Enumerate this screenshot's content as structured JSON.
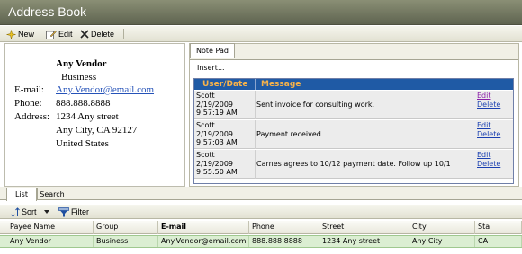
{
  "window": {
    "title": "Address Book"
  },
  "toolbar": {
    "new_label": "New",
    "edit_label": "Edit",
    "delete_label": "Delete"
  },
  "vendor": {
    "name": "Any Vendor",
    "type": "Business",
    "email_label": "E-mail:",
    "email": "Any.Vendor@email.com",
    "phone_label": "Phone:",
    "phone": "888.888.8888",
    "address_label": "Address:",
    "address_line1": "1234 Any street",
    "address_line2": "Any City, CA 92127",
    "address_line3": "United States"
  },
  "notepad": {
    "tab_label": "Note Pad",
    "insert_label": "Insert...",
    "col_user_date": "User/Date",
    "col_message": "Message",
    "rows": [
      {
        "user": "Scott",
        "date": "2/19/2009",
        "time": "9:57:19 AM",
        "message": "Sent invoice for consulting work.",
        "edit": "Edit",
        "delete": "Delete"
      },
      {
        "user": "Scott",
        "date": "2/19/2009",
        "time": "9:57:03 AM",
        "message": "Payment received",
        "edit": "Edit",
        "delete": "Delete"
      },
      {
        "user": "Scott",
        "date": "2/19/2009",
        "time": "9:55:50 AM",
        "message": "Carnes agrees to 10/12 payment date. Follow up 10/1",
        "edit": "Edit",
        "delete": "Delete"
      }
    ]
  },
  "bottom_tabs": {
    "list": "List",
    "search": "Search"
  },
  "listbar": {
    "sort_label": "Sort",
    "filter_label": "Filter"
  },
  "table": {
    "headers": [
      "Payee Name",
      "Group",
      "E-mail",
      "Phone",
      "Street",
      "City",
      "Sta"
    ],
    "row": [
      "Any Vendor",
      "Business",
      "Any.Vendor@email.com",
      "888.888.8888",
      "1234 Any street",
      "Any City",
      "CA"
    ]
  },
  "icons": {
    "new": "new-star-icon",
    "edit": "edit-pencil-icon",
    "delete": "delete-x-icon",
    "sort": "sort-icon",
    "filter": "filter-icon"
  },
  "colors": {
    "titlebar": "#6f735f",
    "grid_header_bg": "#1f5aa5",
    "grid_header_text": "#f6b24a",
    "selected_row": "#dbeed2",
    "link": "#2552b8"
  }
}
